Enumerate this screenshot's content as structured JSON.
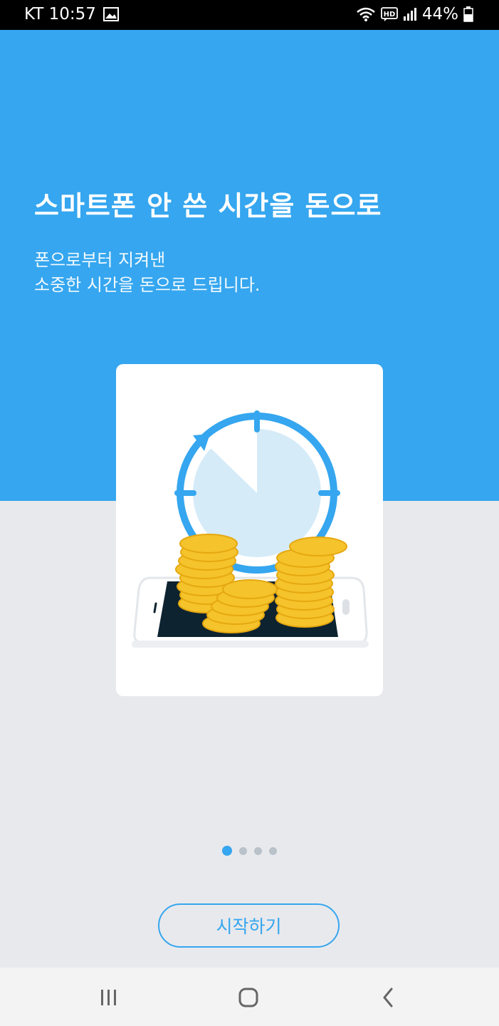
{
  "status_bar": {
    "carrier_time": "KT 10:57",
    "battery": "44%",
    "icons": [
      "gallery-icon",
      "wifi-icon",
      "hd-voice-icon",
      "signal-icon",
      "battery-icon"
    ]
  },
  "onboarding": {
    "title": "스마트폰 안 쓴 시간을 돈으로",
    "subtitle_line1": "폰으로부터 지켜낸",
    "subtitle_line2": "소중한 시간을 돈으로 드립니다.",
    "illustration": "clock-coins-phone-illustration",
    "page_indicator": {
      "total": 4,
      "active": 1
    },
    "start_button_label": "시작하기"
  },
  "nav_bar": {
    "icons": [
      "recent-apps-icon",
      "home-icon",
      "back-icon"
    ]
  },
  "colors": {
    "brand_blue": "#35a6ef",
    "lower_background": "#e8e9ed",
    "coin_gold": "#f5c32c"
  }
}
